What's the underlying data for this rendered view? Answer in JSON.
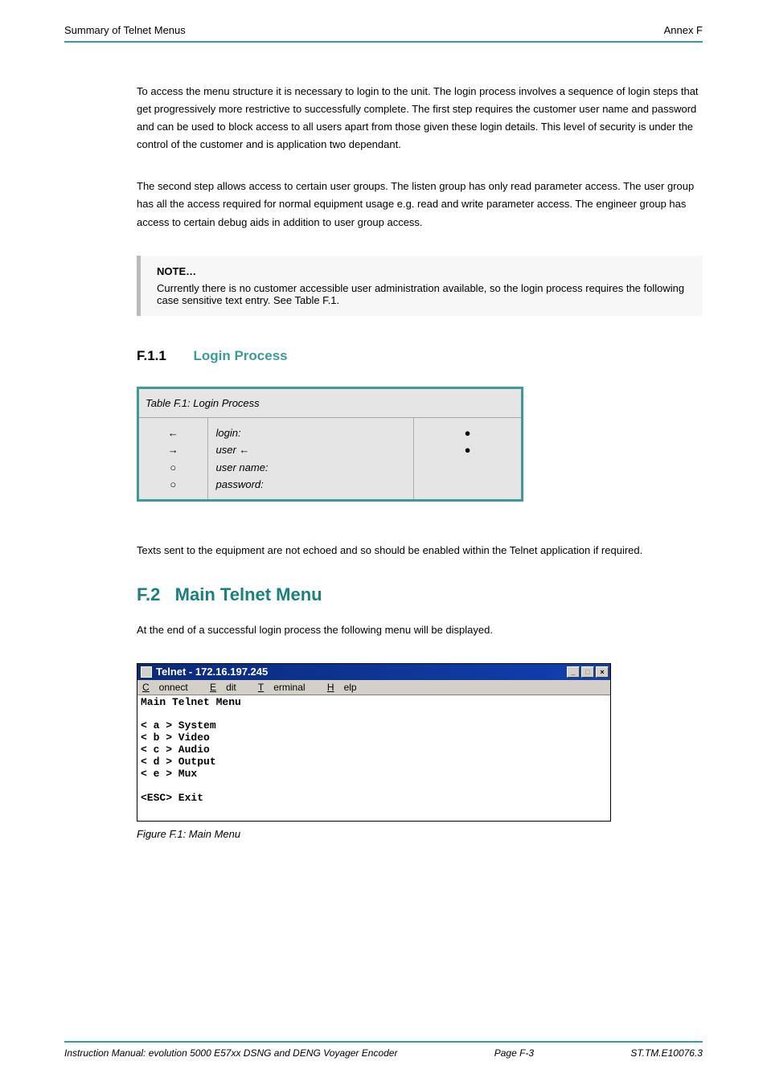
{
  "header": {
    "left": "Summary of Telnet Menus",
    "right": "Annex F"
  },
  "intro": {
    "p1": "To access the menu structure it is necessary to login to the unit. The login process involves a sequence of login steps that get progressively more restrictive to successfully complete. The first step requires the customer user name and password and can be used to block access to all users apart from those given these login details. This level of security is under the control of the customer and is application two dependant.",
    "p2": "The second step allows access to certain user groups. The listen group has only read parameter access. The user group has all the access required for normal equipment usage e.g. read and write parameter access. The engineer group has access to certain debug aids in addition to user group access."
  },
  "note": {
    "label": "NOTE…",
    "text": "Currently there is no customer accessible user administration available, so the login process requires the following case sensitive text entry. See Table F.1."
  },
  "table": {
    "heading_num": "F.1.1",
    "heading_title": "Login Process",
    "title": "Table F.1: Login Process",
    "rows": [
      {
        "c1": "←",
        "c2": "login:",
        "c3": ""
      },
      {
        "c1": "→",
        "c2": "user ←",
        "c3": ""
      },
      {
        "c1": "○",
        "c2": "user name:",
        "c3": "●"
      },
      {
        "c1": "○",
        "c2": "password:",
        "c3": "●"
      }
    ]
  },
  "after_table": "Texts sent to the equipment are not echoed and so should be enabled within the Telnet application if required.",
  "main_menu": {
    "heading": "F.2   Main Telnet Menu",
    "intro": "At the end of a successful login process the following menu will be displayed."
  },
  "telnet": {
    "title": "Telnet - 172.16.197.245",
    "menus": {
      "connect": {
        "u": "C",
        "rest": "onnect"
      },
      "edit": {
        "u": "E",
        "rest": "dit"
      },
      "terminal": {
        "u": "T",
        "rest": "erminal"
      },
      "help": {
        "u": "H",
        "rest": "elp"
      }
    },
    "content": "Main Telnet Menu\n\n< a > System\n< b > Video\n< c > Audio\n< d > Output\n< e > Mux\n\n<ESC> Exit",
    "buttons": {
      "min": "_",
      "max": "□",
      "close": "×"
    },
    "caption": "Figure F.1: Main Menu"
  },
  "footer": {
    "left": "Instruction Manual: evolution 5000 E57xx DSNG and DENG Voyager Encoder",
    "center": "Page F-3",
    "right": "ST.TM.E10076.3"
  }
}
